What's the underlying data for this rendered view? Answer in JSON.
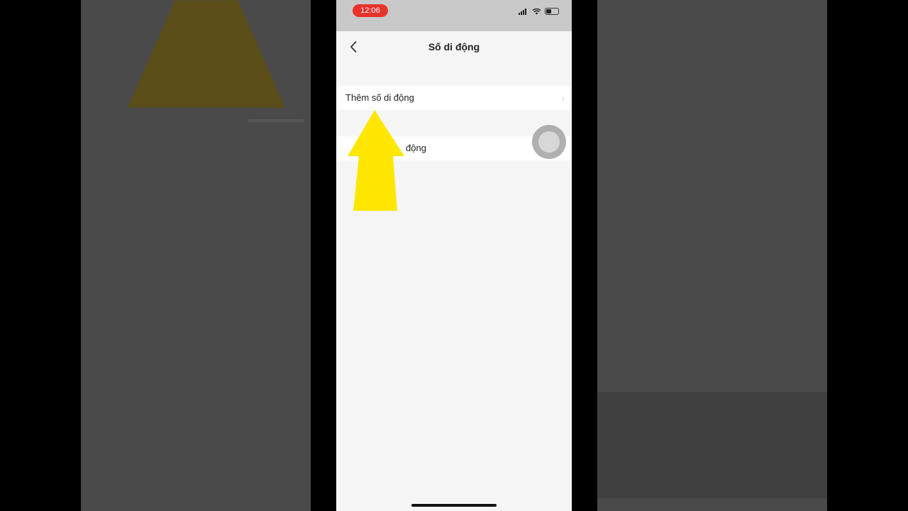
{
  "status_bar": {
    "time": "12:06",
    "icons": [
      "signal-icon",
      "wifi-icon",
      "battery-icon"
    ]
  },
  "nav": {
    "title": "Số di động",
    "back_icon": "chevron-left-icon"
  },
  "list": {
    "add_label": "Thêm số di động",
    "second_label_visible": "động"
  },
  "overlay": {
    "arrow_color": "#ffe600",
    "assistive_touch_icon": "assistive-touch-icon"
  },
  "colors": {
    "time_pill": "#e8322c",
    "background": "#f5f5f5",
    "status_bar": "#c8c8c8"
  }
}
